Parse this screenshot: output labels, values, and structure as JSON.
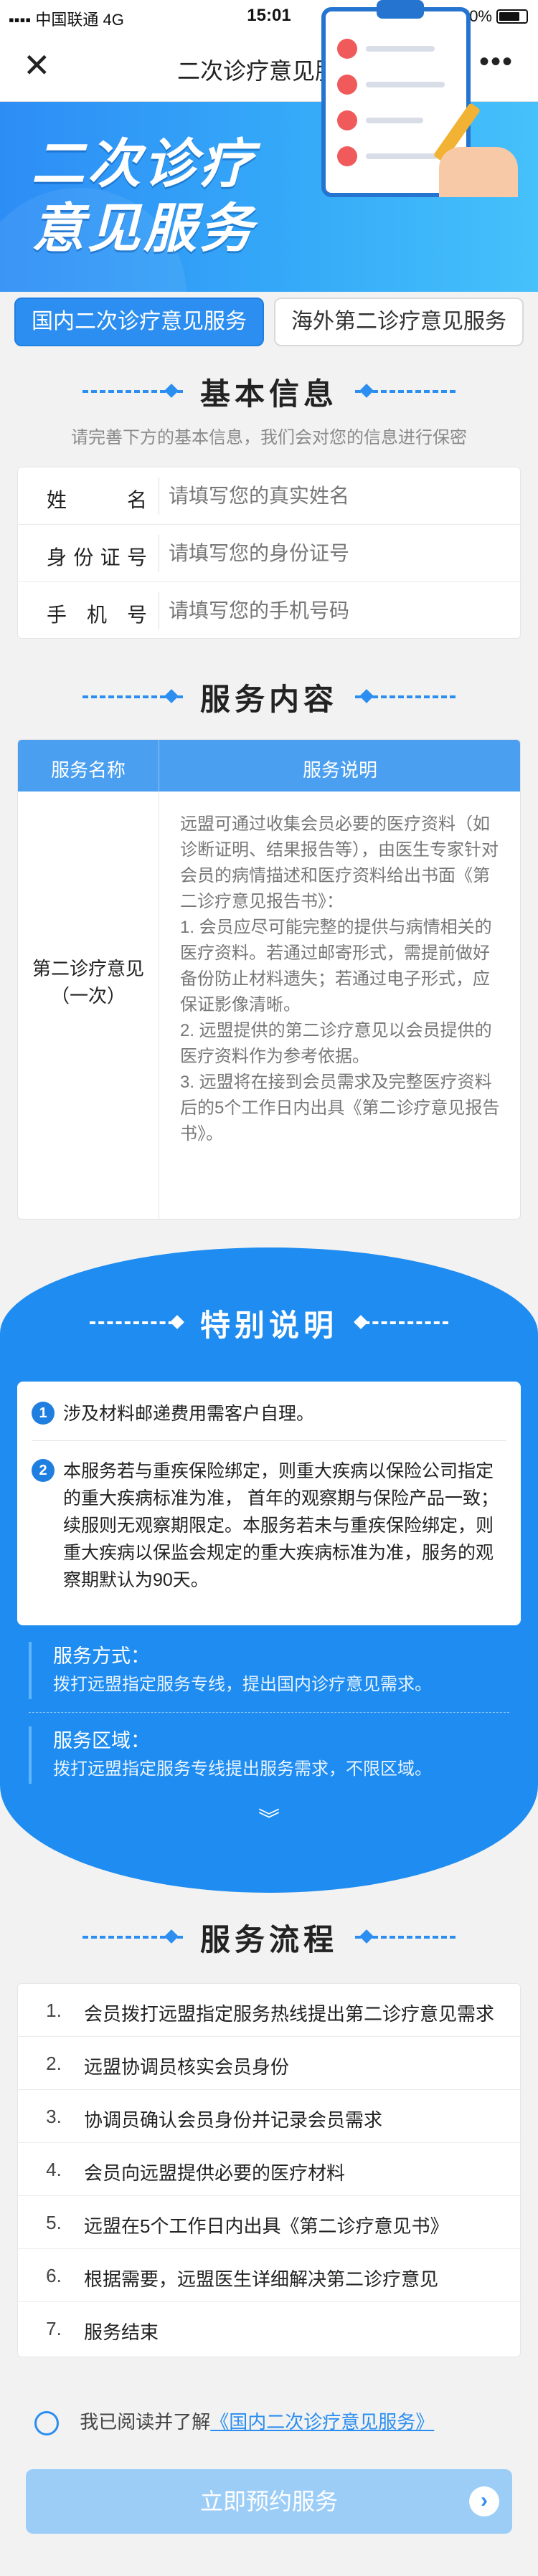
{
  "status_bar": {
    "carrier": "中国联通",
    "network": "4G",
    "time": "15:01",
    "battery": "70%"
  },
  "nav": {
    "title": "二次诊疗意见服务"
  },
  "banner": {
    "title_line1": "二次诊疗",
    "title_line2": "意见服务"
  },
  "tabs": [
    {
      "label": "国内二次诊疗意见服务"
    },
    {
      "label": "海外第二诊疗意见服务"
    }
  ],
  "basic_info": {
    "heading": "基本信息",
    "subtitle": "请完善下方的基本信息，我们会对您的信息进行保密",
    "fields": [
      {
        "label": "姓名",
        "placeholder": "请填写您的真实姓名"
      },
      {
        "label": "身份证号",
        "placeholder": "请填写您的身份证号"
      },
      {
        "label": "手机号",
        "placeholder": "请填写您的手机号码"
      }
    ]
  },
  "service_content": {
    "heading": "服务内容",
    "col_name": "服务名称",
    "col_desc": "服务说明",
    "service_name_line1": "第二诊疗意见",
    "service_name_line2": "（一次）",
    "desc": [
      "远盟可通过收集会员必要的医疗资料（如诊断证明、结果报告等），由医生专家针对会员的病情描述和医疗资料给出书面《第二诊疗意见报告书》：",
      "1. 会员应尽可能完整的提供与病情相关的医疗资料。若通过邮寄形式，需提前做好备份防止材料遗失；若通过电子形式，应保证影像清晰。",
      "2. 远盟提供的第二诊疗意见以会员提供的医疗资料作为参考依据。",
      "3. 远盟将在接到会员需求及完整医疗资料后的5个工作日内出具《第二诊疗意见报告书》。"
    ]
  },
  "special_notes": {
    "heading": "特别说明",
    "notes": [
      {
        "num": "1",
        "text": "涉及材料邮递费用需客户自理。"
      },
      {
        "num": "2",
        "text": "本服务若与重疾保险绑定，则重大疾病以保险公司指定的重大疾病标准为准， 首年的观察期与保险产品一致；续服则无观察期限定。本服务若未与重疾保险绑定，则重大疾病以保监会规定的重大疾病标准为准，服务的观察期默认为90天。"
      }
    ],
    "method_title": "服务方式：",
    "method_desc": "拨打远盟指定服务专线，提出国内诊疗意见需求。",
    "area_title": "服务区域：",
    "area_desc": "拨打远盟指定服务专线提出服务需求，不限区域。"
  },
  "process": {
    "heading": "服务流程",
    "steps": [
      {
        "num": "1.",
        "text": "会员拨打远盟指定服务热线提出第二诊疗意见需求"
      },
      {
        "num": "2.",
        "text": "远盟协调员核实会员身份"
      },
      {
        "num": "3.",
        "text": "协调员确认会员身份并记录会员需求"
      },
      {
        "num": "4.",
        "text": "会员向远盟提供必要的医疗材料"
      },
      {
        "num": "5.",
        "text": "远盟在5个工作日内出具《第二诊疗意见书》"
      },
      {
        "num": "6.",
        "text": "根据需要，远盟医生详细解决第二诊疗意见"
      },
      {
        "num": "7.",
        "text": "服务结束"
      }
    ]
  },
  "agreement": {
    "prefix": "我已阅读并了解",
    "link": "《国内二次诊疗意见服务》"
  },
  "submit_label": "立即预约服务",
  "colors": {
    "primary": "#2b8ef0",
    "special_bg": "#1e8cf0",
    "button_disabled": "#9ccdf7"
  }
}
